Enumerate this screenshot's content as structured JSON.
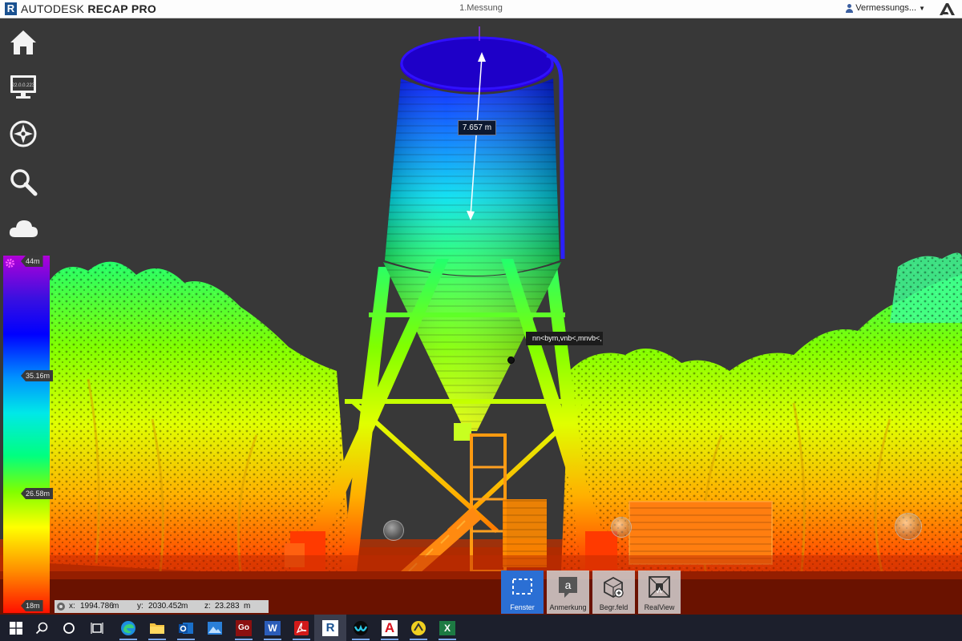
{
  "app": {
    "brand_prefix": "AUTODESK",
    "brand_product": "RECAP PRO",
    "brand_icon_letter": "R",
    "document_title": "1.Messung",
    "user_name": "Vermessungs...",
    "user_menu_icon": "chevron-down-icon"
  },
  "nav": {
    "items": [
      {
        "name": "home",
        "icon": "home-icon"
      },
      {
        "name": "display",
        "icon": "monitor-icon",
        "label": "22.0.0.223"
      },
      {
        "name": "navigation",
        "icon": "compass-icon"
      },
      {
        "name": "search",
        "icon": "magnifier-icon"
      },
      {
        "name": "cloud",
        "icon": "cloud-icon"
      }
    ]
  },
  "scale": {
    "max": "44m",
    "mid_high": "35.16m",
    "mid_low": "26.58m",
    "min": "18m",
    "settings_icon": "gear-icon"
  },
  "viewport": {
    "measurement_value": "7.657 m",
    "note_text": "nn<bym,vnb<,mnvb<,"
  },
  "coordinates": {
    "x_label": "x:",
    "x_value": "1994.786",
    "y_label": "y:",
    "y_value": "2030.452",
    "z_label": "z:",
    "z_value": "23.283",
    "unit": "m"
  },
  "toolbar": {
    "tools": [
      {
        "label": "Fenster",
        "icon": "window-select-icon",
        "active": true
      },
      {
        "label": "Anmerkung",
        "icon": "annotation-icon",
        "glyph": "a",
        "active": false
      },
      {
        "label": "Begr.feld",
        "icon": "limit-box-icon",
        "active": false
      },
      {
        "label": "RealView",
        "icon": "realview-icon",
        "active": false
      }
    ]
  },
  "taskbar": {
    "items": [
      {
        "name": "start",
        "icon": "windows-icon"
      },
      {
        "name": "search",
        "icon": "search-icon"
      },
      {
        "name": "cortana",
        "icon": "circle-icon"
      },
      {
        "name": "task-view",
        "icon": "task-view-icon"
      },
      {
        "name": "edge",
        "icon": "edge-icon"
      },
      {
        "name": "file-explorer",
        "icon": "folder-icon"
      },
      {
        "name": "outlook",
        "icon": "outlook-icon"
      },
      {
        "name": "photos",
        "icon": "photos-icon"
      },
      {
        "name": "app-go",
        "icon": "app-go-icon",
        "glyph": "Go"
      },
      {
        "name": "word",
        "icon": "word-icon",
        "glyph": "W"
      },
      {
        "name": "acrobat",
        "icon": "acrobat-icon"
      },
      {
        "name": "recap",
        "icon": "recap-icon",
        "glyph": "R"
      },
      {
        "name": "webex",
        "icon": "webex-icon"
      },
      {
        "name": "autocad",
        "icon": "autocad-icon",
        "glyph": "A"
      },
      {
        "name": "app-yellow",
        "icon": "yellow-app-icon"
      },
      {
        "name": "excel",
        "icon": "excel-icon",
        "glyph": "X"
      }
    ]
  }
}
